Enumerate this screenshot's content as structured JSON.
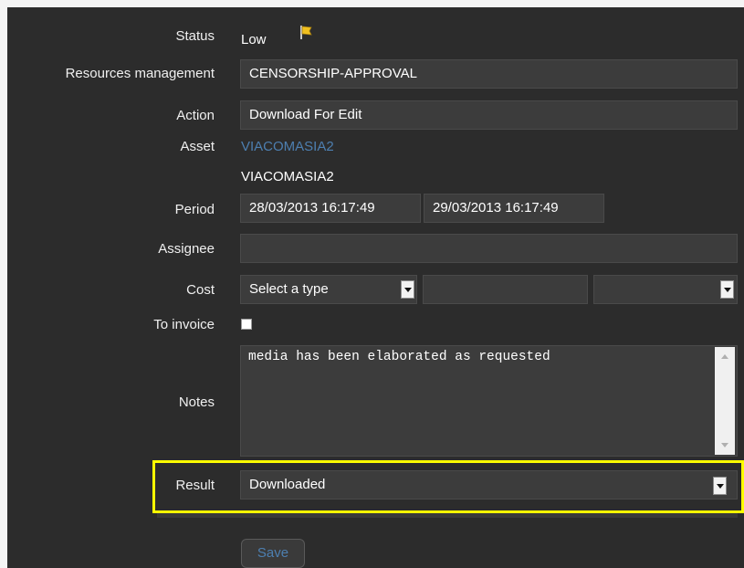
{
  "status": {
    "label": "Status",
    "value": "Low",
    "icon": "flag-icon"
  },
  "resources": {
    "label": "Resources management",
    "value": "CENSORSHIP-APPROVAL"
  },
  "action": {
    "label": "Action",
    "value": "Download For Edit"
  },
  "asset": {
    "label": "Asset",
    "link": "VIACOMASIA2",
    "text": "VIACOMASIA2"
  },
  "period": {
    "label": "Period",
    "start": "28/03/2013 16:17:49",
    "end": "29/03/2013 16:17:49"
  },
  "assignee": {
    "label": "Assignee",
    "value": ""
  },
  "cost": {
    "label": "Cost",
    "type_selected": "Select a type",
    "amount": "",
    "currency": ""
  },
  "invoice": {
    "label": "To invoice",
    "checked": false
  },
  "notes": {
    "label": "Notes",
    "value": "media has been elaborated as requested"
  },
  "result": {
    "label": "Result",
    "selected": "Downloaded"
  },
  "save": {
    "label": "Save"
  },
  "colors": {
    "panel": "#2c2c2c",
    "field": "#3c3c3c",
    "link": "#4d7fb0",
    "highlight": "#ffff00"
  }
}
